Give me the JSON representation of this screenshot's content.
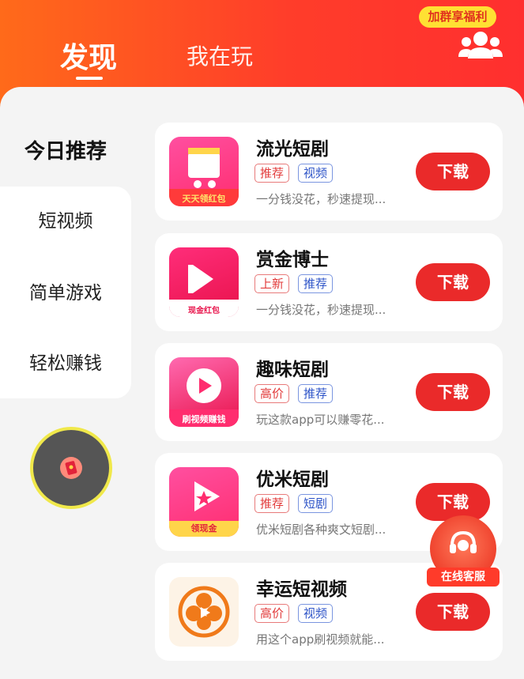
{
  "header": {
    "tabs": [
      {
        "label": "发现",
        "active": true
      },
      {
        "label": "我在玩",
        "active": false
      }
    ],
    "group_badge": "加群享福利"
  },
  "sidebar": {
    "active": "今日推荐",
    "items": [
      {
        "label": "短视频"
      },
      {
        "label": "简单游戏"
      },
      {
        "label": "轻松赚钱"
      }
    ]
  },
  "apps": [
    {
      "name": "流光短剧",
      "tags": [
        {
          "text": "推荐",
          "color": "red"
        },
        {
          "text": "视频",
          "color": "blue"
        }
      ],
      "desc": "一分钱没花，秒速提现...",
      "button": "下载",
      "icon_caption": "天天领红包"
    },
    {
      "name": "赏金博士",
      "tags": [
        {
          "text": "上新",
          "color": "red"
        },
        {
          "text": "推荐",
          "color": "blue"
        }
      ],
      "desc": "一分钱没花，秒速提现...",
      "button": "下载",
      "icon_caption": "现金红包"
    },
    {
      "name": "趣味短剧",
      "tags": [
        {
          "text": "高价",
          "color": "red"
        },
        {
          "text": "推荐",
          "color": "blue"
        }
      ],
      "desc": "玩这款app可以赚零花...",
      "button": "下载",
      "icon_caption": "刷视频赚钱"
    },
    {
      "name": "优米短剧",
      "tags": [
        {
          "text": "推荐",
          "color": "red"
        },
        {
          "text": "短剧",
          "color": "blue"
        }
      ],
      "desc": "优米短剧各种爽文短剧...",
      "button": "下载",
      "icon_caption": "领现金"
    },
    {
      "name": "幸运短视频",
      "tags": [
        {
          "text": "高价",
          "color": "red"
        },
        {
          "text": "视频",
          "color": "blue"
        }
      ],
      "desc": "用这个app刷视频就能...",
      "button": "下载",
      "icon_caption": ""
    }
  ],
  "service": {
    "label": "在线客服"
  },
  "colors": {
    "brand": "#ff3d2a",
    "download": "#ea2a2a",
    "tag_red": "#e23b3b",
    "tag_blue": "#2f55c8"
  }
}
